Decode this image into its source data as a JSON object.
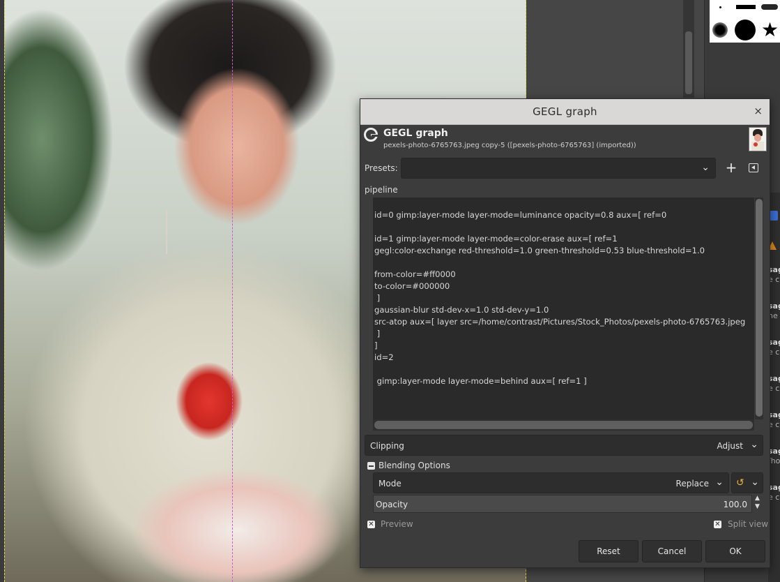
{
  "dialog": {
    "window_title": "GEGL graph",
    "close_glyph": "×",
    "header_title": "GEGL graph",
    "header_subtitle": "pexels-photo-6765763.jpeg copy-5 ([pexels-photo-6765763] (imported))",
    "presets_label": "Presets:",
    "presets_value": "",
    "add_glyph": "+",
    "pipeline_label": "pipeline",
    "pipeline_text": "\nid=0 gimp:layer-mode layer-mode=luminance opacity=0.8 aux=[ ref=0\n\nid=1 gimp:layer-mode layer-mode=color-erase aux=[ ref=1\ngegl:color-exchange red-threshold=1.0 green-threshold=0.53 blue-threshold=1.0\n\nfrom-color=#ff0000\nto-color=#000000\n ]\ngaussian-blur std-dev-x=1.0 std-dev-y=1.0\nsrc-atop aux=[ layer src=/home/contrast/Pictures/Stock_Photos/pexels-photo-6765763.jpeg\n ]\n]\nid=2\n\n gimp:layer-mode layer-mode=behind aux=[ ref=1 ]",
    "clipping_label": "Clipping",
    "clipping_value": "Adjust",
    "blending_options_label": "Blending Options",
    "mode_label": "Mode",
    "mode_value": "Replace",
    "opacity_label": "Opacity",
    "opacity_value": "100.0",
    "preview_label": "Preview",
    "split_view_label": "Split view",
    "reset_label": "Reset",
    "cancel_label": "Cancel",
    "ok_label": "OK",
    "chevron_glyph": "⌄",
    "spin_up_glyph": "▲",
    "spin_down_glyph": "▼",
    "check_glyph": "✕",
    "mode_switch_glyph": "↺"
  },
  "dock": {
    "entries": [
      {
        "line1": "sag",
        "line2": "e c"
      },
      {
        "line1": "sag",
        "line2": "ne c"
      },
      {
        "line1": "sag",
        "line2": "e c"
      },
      {
        "line1": "sag",
        "line2": "e c"
      },
      {
        "line1": "sag",
        "line2": "e c"
      },
      {
        "line1": "sag",
        "line2": "/ho"
      },
      {
        "line1": "sag",
        "line2": "e c"
      }
    ]
  },
  "icons": {
    "gegl_logo": "gegl-logo-icon",
    "close": "close-icon",
    "add_preset": "plus-icon",
    "preset_menu": "menu-icon",
    "mode_switch": "swap-icon"
  },
  "colors": {
    "dialog_bg": "#3c3c3c",
    "titlebar_bg": "#d9d8d6",
    "text_area_bg": "#2a2a2a",
    "guide_yellow": "#e2d64a",
    "split_magenta": "#d05ad0",
    "mode_icon": "#e9b43b"
  }
}
